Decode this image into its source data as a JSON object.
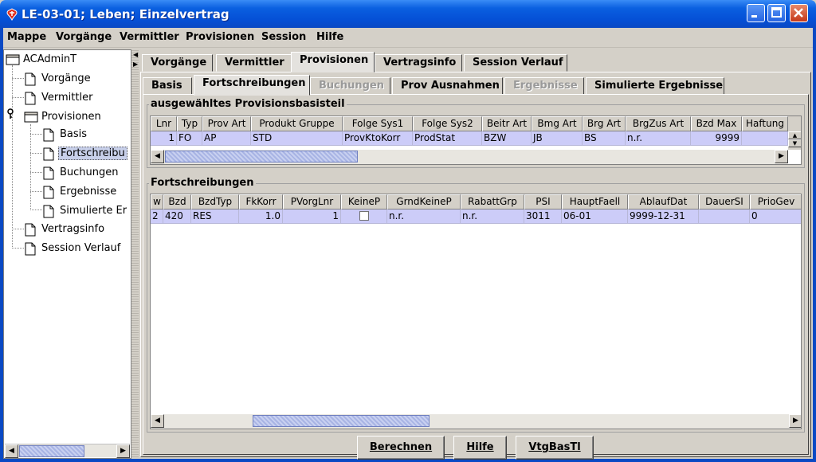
{
  "window": {
    "title": "LE-03-01; Leben; Einzelvertrag"
  },
  "menu": {
    "items": [
      "Mappe",
      "Vorgänge",
      "Vermittler",
      "Provisionen",
      "Session",
      "Hilfe"
    ]
  },
  "tree": {
    "root": "ACAdminT",
    "items": [
      {
        "label": "Vorgänge"
      },
      {
        "label": "Vermittler"
      },
      {
        "label": "Provisionen"
      },
      {
        "label": "Basis"
      },
      {
        "label": "Fortschreibu"
      },
      {
        "label": "Buchungen"
      },
      {
        "label": "Ergebnisse"
      },
      {
        "label": "Simulierte Er"
      },
      {
        "label": "Vertragsinfo"
      },
      {
        "label": "Session Verlauf"
      }
    ]
  },
  "main_tabs": [
    "Vorgänge",
    "Vermittler",
    "Provisionen",
    "Vertragsinfo",
    "Session Verlauf"
  ],
  "sub_tabs": [
    "Basis",
    "Fortschreibungen",
    "Buchungen",
    "Prov Ausnahmen",
    "Ergebnisse",
    "Simulierte Ergebnisse"
  ],
  "basis_group": {
    "title": "ausgewähltes Provisionsbasisteil",
    "columns": [
      "Lnr",
      "Typ",
      "Prov Art",
      "Produkt Gruppe",
      "Folge Sys1",
      "Folge Sys2",
      "Beitr Art",
      "Bmg Art",
      "Brg Art",
      "BrgZus Art",
      "Bzd Max",
      "Haftung"
    ],
    "row": [
      "1",
      "FO",
      "AP",
      "STD",
      "ProvKtoKorr",
      "ProdStat",
      "BZW",
      "JB",
      "BS",
      "n.r.",
      "9999",
      ""
    ]
  },
  "fort_group": {
    "title": "Fortschreibungen",
    "columns": [
      "w",
      "Bzd",
      "BzdTyp",
      "FkKorr",
      "PVorgLnr",
      "KeineP",
      "GrndKeineP",
      "RabattGrp",
      "PSI",
      "HauptFaell",
      "AblaufDat",
      "DauerSI",
      "PrioGev"
    ],
    "row": [
      "2",
      "420",
      "RES",
      "1.0",
      "1",
      "",
      "n.r.",
      "n.r.",
      "3011",
      "06-01",
      "9999-12-31",
      "",
      "0"
    ]
  },
  "buttons": {
    "berechnen": "Berechnen",
    "hilfe": "Hilfe",
    "vtgbastl": "VtgBasTl"
  }
}
